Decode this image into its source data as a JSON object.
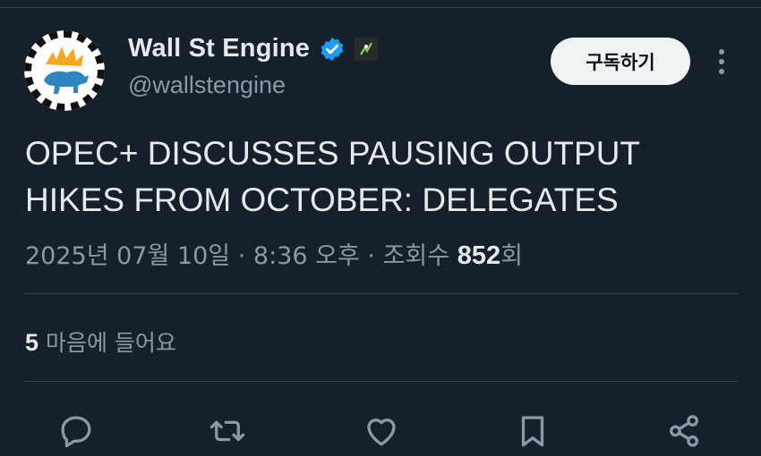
{
  "account": {
    "name": "Wall St Engine",
    "handle": "@wallstengine",
    "verified_icon": "verified-badge-icon",
    "affiliate_icon": "affiliate-logo-icon",
    "subscribe_label": "구독하기"
  },
  "tweet": {
    "text": "OPEC+ DISCUSSES PAUSING OUTPUT HIKES FROM OCTOBER: DELEGATES",
    "date": "2025년 07월 10일",
    "separator": "·",
    "time": "8:36 오후",
    "views_label": "조회수",
    "views_count": "852",
    "views_suffix": "회"
  },
  "engagement": {
    "likes_count": "5",
    "likes_label": "마음에 들어요"
  },
  "actions": [
    {
      "icon": "reply-icon"
    },
    {
      "icon": "retweet-icon"
    },
    {
      "icon": "like-icon"
    },
    {
      "icon": "bookmark-icon"
    },
    {
      "icon": "share-icon"
    }
  ],
  "colors": {
    "background": "#15202b",
    "text": "#e7e9ea",
    "secondary": "#8b98a5",
    "divider": "#38444d",
    "verified": "#1d9bf0",
    "button_bg": "#eff3f4"
  }
}
